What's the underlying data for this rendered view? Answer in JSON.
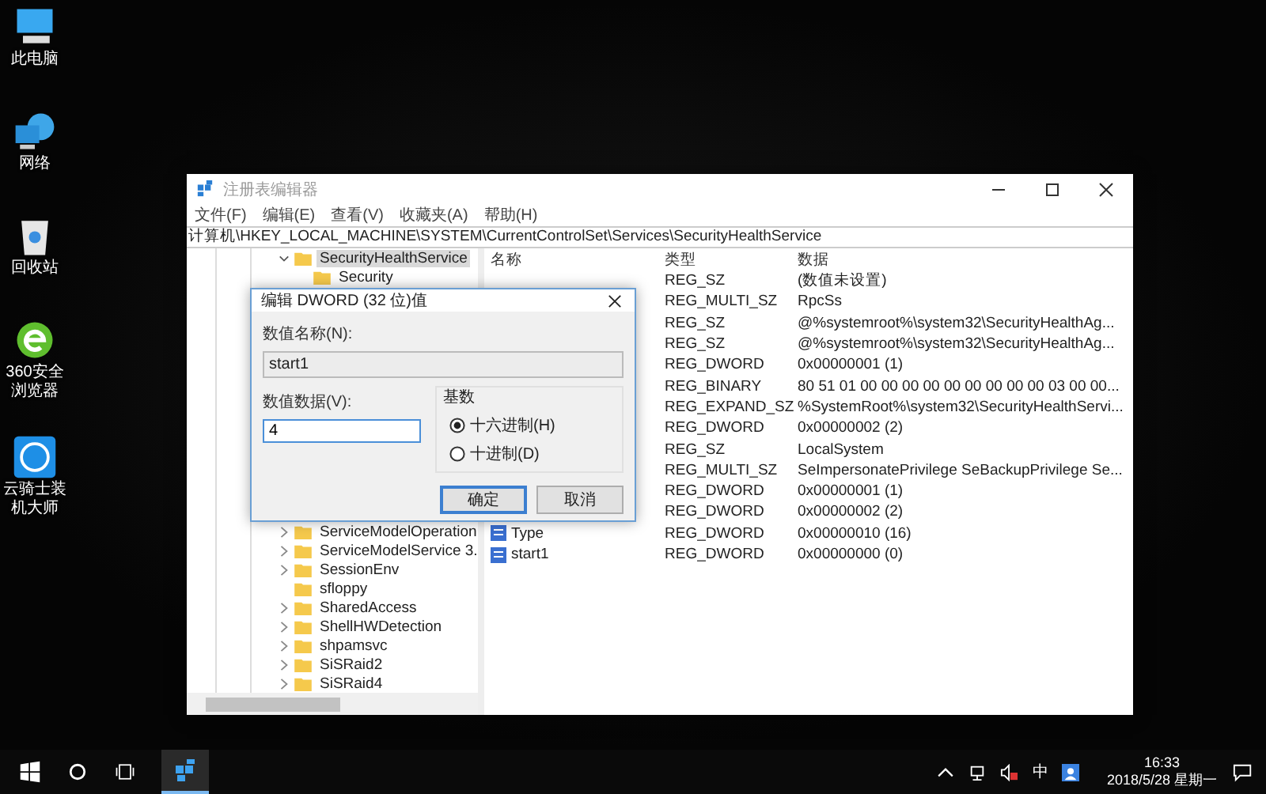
{
  "desktop_icons": [
    {
      "label": "此电脑",
      "kind": "computer"
    },
    {
      "label": "网络",
      "kind": "network"
    },
    {
      "label": "回收站",
      "kind": "recycle"
    },
    {
      "label": "360安全浏览器",
      "kind": "browser"
    },
    {
      "label": "云骑士装机大师",
      "kind": "app"
    }
  ],
  "window": {
    "title": "注册表编辑器",
    "menu": [
      "文件(F)",
      "编辑(E)",
      "查看(V)",
      "收藏夹(A)",
      "帮助(H)"
    ],
    "address": "计算机\\HKEY_LOCAL_MACHINE\\SYSTEM\\CurrentControlSet\\Services\\SecurityHealthService",
    "tree_top": [
      {
        "label": "SecurityHealthService",
        "has_children": true,
        "expanded": true,
        "selected": true,
        "children": [
          {
            "label": "Security",
            "has_children": false,
            "selected": false
          }
        ]
      }
    ],
    "tree_bottom": [
      {
        "label": "ServiceModelOperation",
        "has_children": true,
        "expanded": false,
        "selected": false
      },
      {
        "label": "ServiceModelService 3.",
        "has_children": true,
        "expanded": false,
        "selected": false
      },
      {
        "label": "SessionEnv",
        "has_children": true,
        "expanded": false,
        "selected": false
      },
      {
        "label": "sfloppy",
        "has_children": false,
        "selected": false
      },
      {
        "label": "SharedAccess",
        "has_children": true,
        "expanded": false,
        "selected": false
      },
      {
        "label": "ShellHWDetection",
        "has_children": true,
        "expanded": false,
        "selected": false
      },
      {
        "label": "shpamsvc",
        "has_children": true,
        "expanded": false,
        "selected": false
      },
      {
        "label": "SiSRaid2",
        "has_children": true,
        "expanded": false,
        "selected": false
      },
      {
        "label": "SiSRaid4",
        "has_children": true,
        "expanded": false,
        "selected": false
      }
    ],
    "columns": [
      "名称",
      "类型",
      "数据"
    ],
    "rows": [
      {
        "type": "REG_SZ",
        "data": "(数值未设置)"
      },
      {
        "type": "REG_MULTI_SZ",
        "data": "RpcSs"
      },
      {
        "type": "REG_SZ",
        "data": "@%systemroot%\\system32\\SecurityHealthAg..."
      },
      {
        "type": "REG_SZ",
        "data": "@%systemroot%\\system32\\SecurityHealthAg..."
      },
      {
        "type": "REG_DWORD",
        "data": "0x00000001 (1)"
      },
      {
        "type": "REG_BINARY",
        "data": "80 51 01 00 00 00 00 00 00 00 00 00 03 00 00..."
      },
      {
        "type": "REG_EXPAND_SZ",
        "data": "%SystemRoot%\\system32\\SecurityHealthServi..."
      },
      {
        "type": "REG_DWORD",
        "data": "0x00000002 (2)"
      },
      {
        "type": "REG_SZ",
        "data": "LocalSystem"
      },
      {
        "type": "REG_MULTI_SZ",
        "data": "SeImpersonatePrivilege SeBackupPrivilege Se..."
      },
      {
        "type": "REG_DWORD",
        "data": "0x00000001 (1)"
      },
      {
        "type": "REG_DWORD",
        "data": "0x00000002 (2)"
      },
      {
        "name": "Type",
        "type": "REG_DWORD",
        "data": "0x00000010 (16)"
      },
      {
        "name": "start1",
        "type": "REG_DWORD",
        "data": "0x00000000 (0)"
      }
    ]
  },
  "dialog": {
    "title": "编辑 DWORD (32 位)值",
    "name_label": "数值名称(N):",
    "name_value": "start1",
    "data_label": "数值数据(V):",
    "data_value": "4",
    "base_label": "基数",
    "radios": [
      {
        "label": "十六进制(H)",
        "selected": true
      },
      {
        "label": "十进制(D)",
        "selected": false
      }
    ],
    "buttons": [
      {
        "label": "确定",
        "default": true
      },
      {
        "label": "取消",
        "default": false
      }
    ]
  },
  "taskbar": {
    "apps": [
      {
        "kind": "regedit",
        "active": true
      }
    ],
    "ime": "中",
    "time": "16:33",
    "date": "2018/5/28 星期一"
  }
}
